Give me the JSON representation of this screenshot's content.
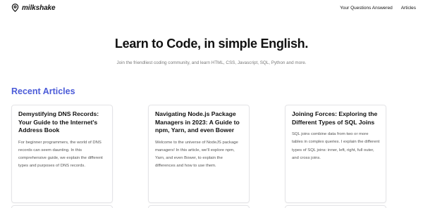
{
  "header": {
    "brand": "milkshake",
    "brand_icon": "location-pin-icon",
    "nav": [
      {
        "label": "Your Questions Answered"
      },
      {
        "label": "Articles"
      }
    ]
  },
  "hero": {
    "title": "Learn to Code, in simple English.",
    "subtitle": "Join the friendliest coding community, and learn HTML, CSS, Javascript, SQL, Python and more."
  },
  "recent": {
    "heading": "Recent Articles",
    "heading_color": "#4b5bd8",
    "articles": [
      {
        "title": "Demystifying DNS Records: Your Guide to the Internet's Address Book",
        "description": "For beginner programmers, the world of DNS records can seem daunting. In this comprehensive guide, we explain the different types and purposes of DNS records."
      },
      {
        "title": "Navigating Node.js Package Managers in 2023: A Guide to npm, Yarn, and even Bower",
        "description": "Welcome to the universe of NodeJS package managers! In this article, we'll explore npm, Yarn, and even Bower, to explain the differences and how to use them."
      },
      {
        "title": "Joining Forces: Exploring the Different Types of SQL Joins",
        "description": "SQL joins combine data from two or more tables in complex queries. I explain the different types of SQL joins: inner, left, right, full outer, and cross joins."
      }
    ]
  }
}
